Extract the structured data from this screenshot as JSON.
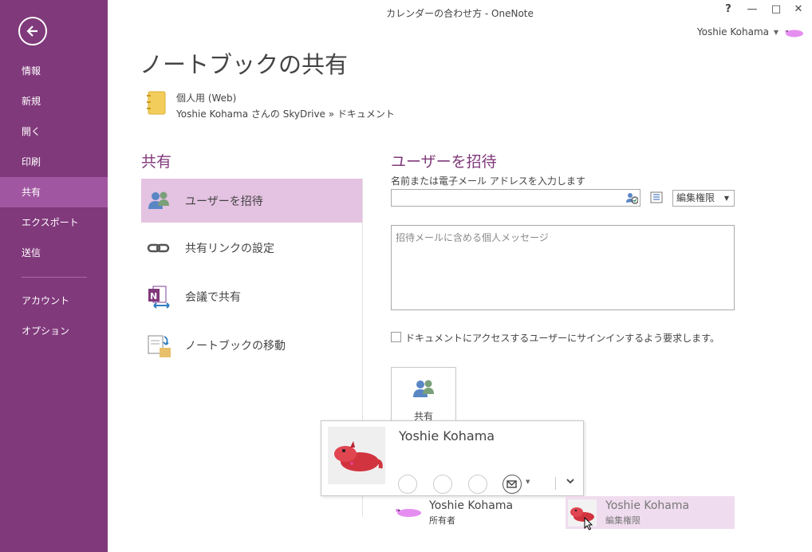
{
  "window": {
    "title": "カレンダーの合わせ方 - OneNote",
    "help_label": "?",
    "minimize_label": "—",
    "maximize_label": "□",
    "close_label": "✕",
    "user_name": "Yoshie Kohama"
  },
  "sidebar": {
    "back_icon": "back-arrow-icon",
    "items": [
      {
        "label": "情報"
      },
      {
        "label": "新規"
      },
      {
        "label": "開く"
      },
      {
        "label": "印刷"
      },
      {
        "label": "共有",
        "active": true
      },
      {
        "label": "エクスポート"
      },
      {
        "label": "送信"
      },
      {
        "label": "アカウント"
      },
      {
        "label": "オプション"
      }
    ],
    "accent_color": "#80397b",
    "active_color": "#a056a0"
  },
  "main": {
    "title": "ノートブックの共有",
    "notebook": {
      "name": "個人用 (Web)",
      "path": "Yoshie Kohama さんの SkyDrive » ドキュメント"
    },
    "share_section": {
      "title": "共有",
      "options": [
        {
          "label": "ユーザーを招待",
          "icon": "invite-people-icon",
          "active": true
        },
        {
          "label": "共有リンクの設定",
          "icon": "link-icon"
        },
        {
          "label": "会議で共有",
          "icon": "onenote-meeting-icon"
        },
        {
          "label": "ノートブックの移動",
          "icon": "move-notebook-icon"
        }
      ]
    },
    "invite": {
      "title": "ユーザーを招待",
      "field_label": "名前または電子メール アドレスを入力します",
      "name_value": "",
      "permission": "編集権限",
      "message_placeholder": "招待メールに含める個人メッセージ",
      "require_signin_label": "ドキュメントにアクセスするユーザーにサインインするよう要求します。",
      "require_signin_checked": false,
      "share_button_label": "共有"
    },
    "contact_card": {
      "name": "Yoshie Kohama"
    },
    "shared_with": [
      {
        "name": "Yoshie Kohama",
        "role": "所有者"
      },
      {
        "name": "Yoshie Kohama",
        "role": "編集権限"
      }
    ]
  }
}
